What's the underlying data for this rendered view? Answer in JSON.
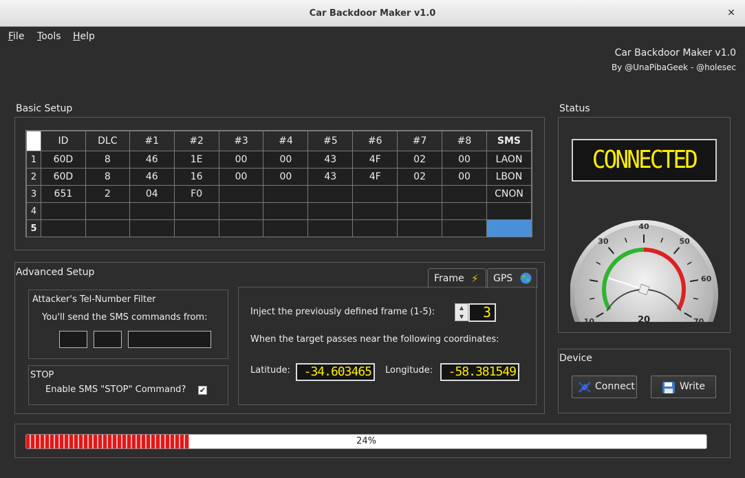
{
  "window": {
    "title": "Car Backdoor Maker v1.0",
    "close_glyph": "✕"
  },
  "menu": [
    {
      "label": "File",
      "key": "F",
      "rest": "ile"
    },
    {
      "label": "Tools",
      "key": "T",
      "rest": "ools"
    },
    {
      "label": "Help",
      "key": "H",
      "rest": "elp"
    }
  ],
  "credits": {
    "line1": "Car Backdoor Maker v1.0",
    "line2": "By @UnaPibaGeek - @holesec"
  },
  "basic_setup": {
    "title": "Basic Setup",
    "columns": [
      "ID",
      "DLC",
      "#1",
      "#2",
      "#3",
      "#4",
      "#5",
      "#6",
      "#7",
      "#8",
      "SMS"
    ],
    "rows": [
      {
        "num": "1",
        "cells": [
          "60D",
          "8",
          "46",
          "1E",
          "00",
          "00",
          "43",
          "4F",
          "02",
          "00",
          "LAON"
        ]
      },
      {
        "num": "2",
        "cells": [
          "60D",
          "8",
          "46",
          "16",
          "00",
          "00",
          "43",
          "4F",
          "02",
          "00",
          "LBON"
        ]
      },
      {
        "num": "3",
        "cells": [
          "651",
          "2",
          "04",
          "F0",
          "",
          "",
          "",
          "",
          "",
          "",
          "CNON"
        ]
      },
      {
        "num": "4",
        "cells": [
          "",
          "",
          "",
          "",
          "",
          "",
          "",
          "",
          "",
          "",
          ""
        ]
      },
      {
        "num": "5",
        "cells": [
          "",
          "",
          "",
          "",
          "",
          "",
          "",
          "",
          "",
          "",
          ""
        ]
      }
    ]
  },
  "status": {
    "title": "Status",
    "display": "CONNECTED",
    "gauge": {
      "ticks": [
        "10",
        "20",
        "30",
        "40",
        "50",
        "60",
        "70"
      ],
      "center_label": "20",
      "value": 20
    }
  },
  "advanced_setup": {
    "title": "Advanced Setup",
    "tel_filter": {
      "title": "Attacker's Tel-Number Filter",
      "text": "You'll send the SMS commands from:"
    },
    "stop": {
      "title": "STOP",
      "label": "Enable SMS \"STOP\" Command?",
      "checked": true
    },
    "tabs": [
      {
        "label": "Frame",
        "icon": "lightning-icon"
      },
      {
        "label": "GPS",
        "icon": "globe-icon"
      }
    ],
    "gps": {
      "inject_label": "Inject the previously defined frame (1-5):",
      "frame_value": "3",
      "coords_label": "When the target passes near the following coordinates:",
      "latitude_label": "Latitude:",
      "latitude_value": "-34.603465",
      "longitude_label": "Longitude:",
      "longitude_value": "-58.381549"
    }
  },
  "device": {
    "title": "Device",
    "connect_label": "Connect",
    "write_label": "Write"
  },
  "progress": {
    "value": 24,
    "label": "24%"
  },
  "colors": {
    "accent": "#4a90d9",
    "lcd": "#ffee00",
    "progress": "#e01818"
  }
}
